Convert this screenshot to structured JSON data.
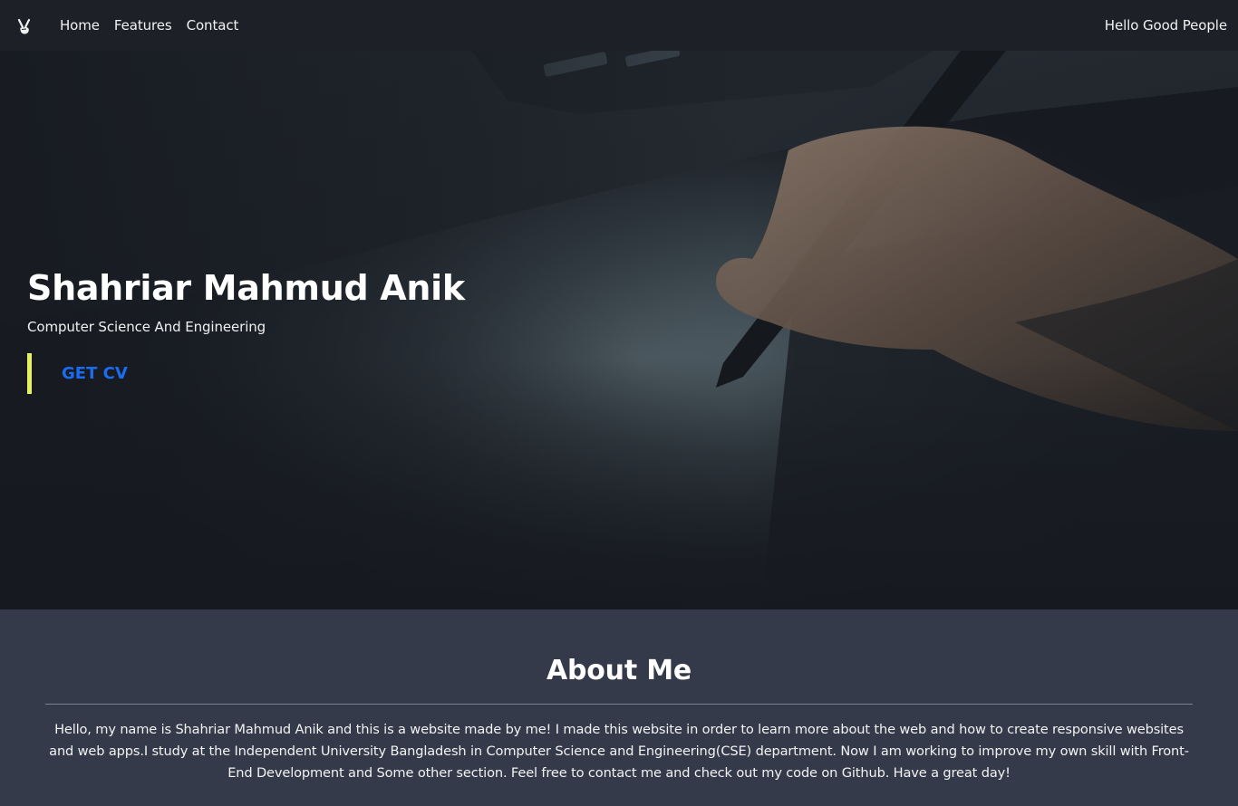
{
  "nav": {
    "logo_icon": "victory-hand-icon",
    "links": [
      "Home",
      "Features",
      "Contact"
    ],
    "greeting": "Hello Good People"
  },
  "hero": {
    "background_image": "dark-photo-of-hand-holding-pen",
    "title": "Shahriar Mahmud Anik",
    "subtitle": "Computer Science And Engineering",
    "cv_button": "GET CV"
  },
  "about": {
    "title": "About Me",
    "text": "Hello, my name is Shahriar Mahmud Anik and this is a website made by me! I made this website in order to learn more about the web and how to create responsive websites and web apps.I study at the Independent University Bangladesh in Computer Science and Engineering(CSE) department. Now I am working to improve my own skill with Front-End Development and Some other section. Feel free to contact me and check out my code on Github. Have a great day!"
  },
  "colors": {
    "navbar_bg": "#1d2026",
    "about_bg": "#353a4a",
    "cv_text": "#1a6cf0",
    "cv_accent": "#e4f25c"
  }
}
